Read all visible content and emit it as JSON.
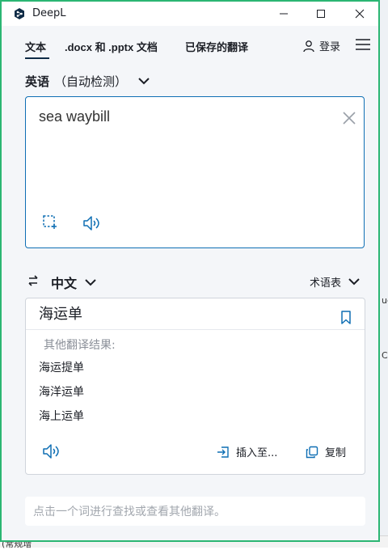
{
  "window": {
    "title": "DeepL"
  },
  "tabs": [
    {
      "label": "文本"
    },
    {
      "label": ".docx 和 .pptx 文档"
    },
    {
      "label": "已保存的翻译"
    }
  ],
  "header": {
    "login_label": "登录"
  },
  "source": {
    "lang_label": "英语",
    "detect_label": "（自动检测）",
    "text": "sea waybill"
  },
  "target": {
    "lang_label": "中文",
    "glossary_label": "术语表",
    "main_translation": "海运单",
    "alternatives_heading": "其他翻译结果:",
    "alternatives": [
      "海运提单",
      "海洋运单",
      "海上运单"
    ],
    "insert_label": "插入至...",
    "copy_label": "复制"
  },
  "hint": {
    "text": "点击一个词进行查找或查看其他翻译。"
  },
  "colors": {
    "accent": "#0f6fb4",
    "window_border": "#2bb673",
    "brand": "#0f2b46"
  },
  "background_fragments": [
    "(常规增",
    "ue",
    "C"
  ]
}
